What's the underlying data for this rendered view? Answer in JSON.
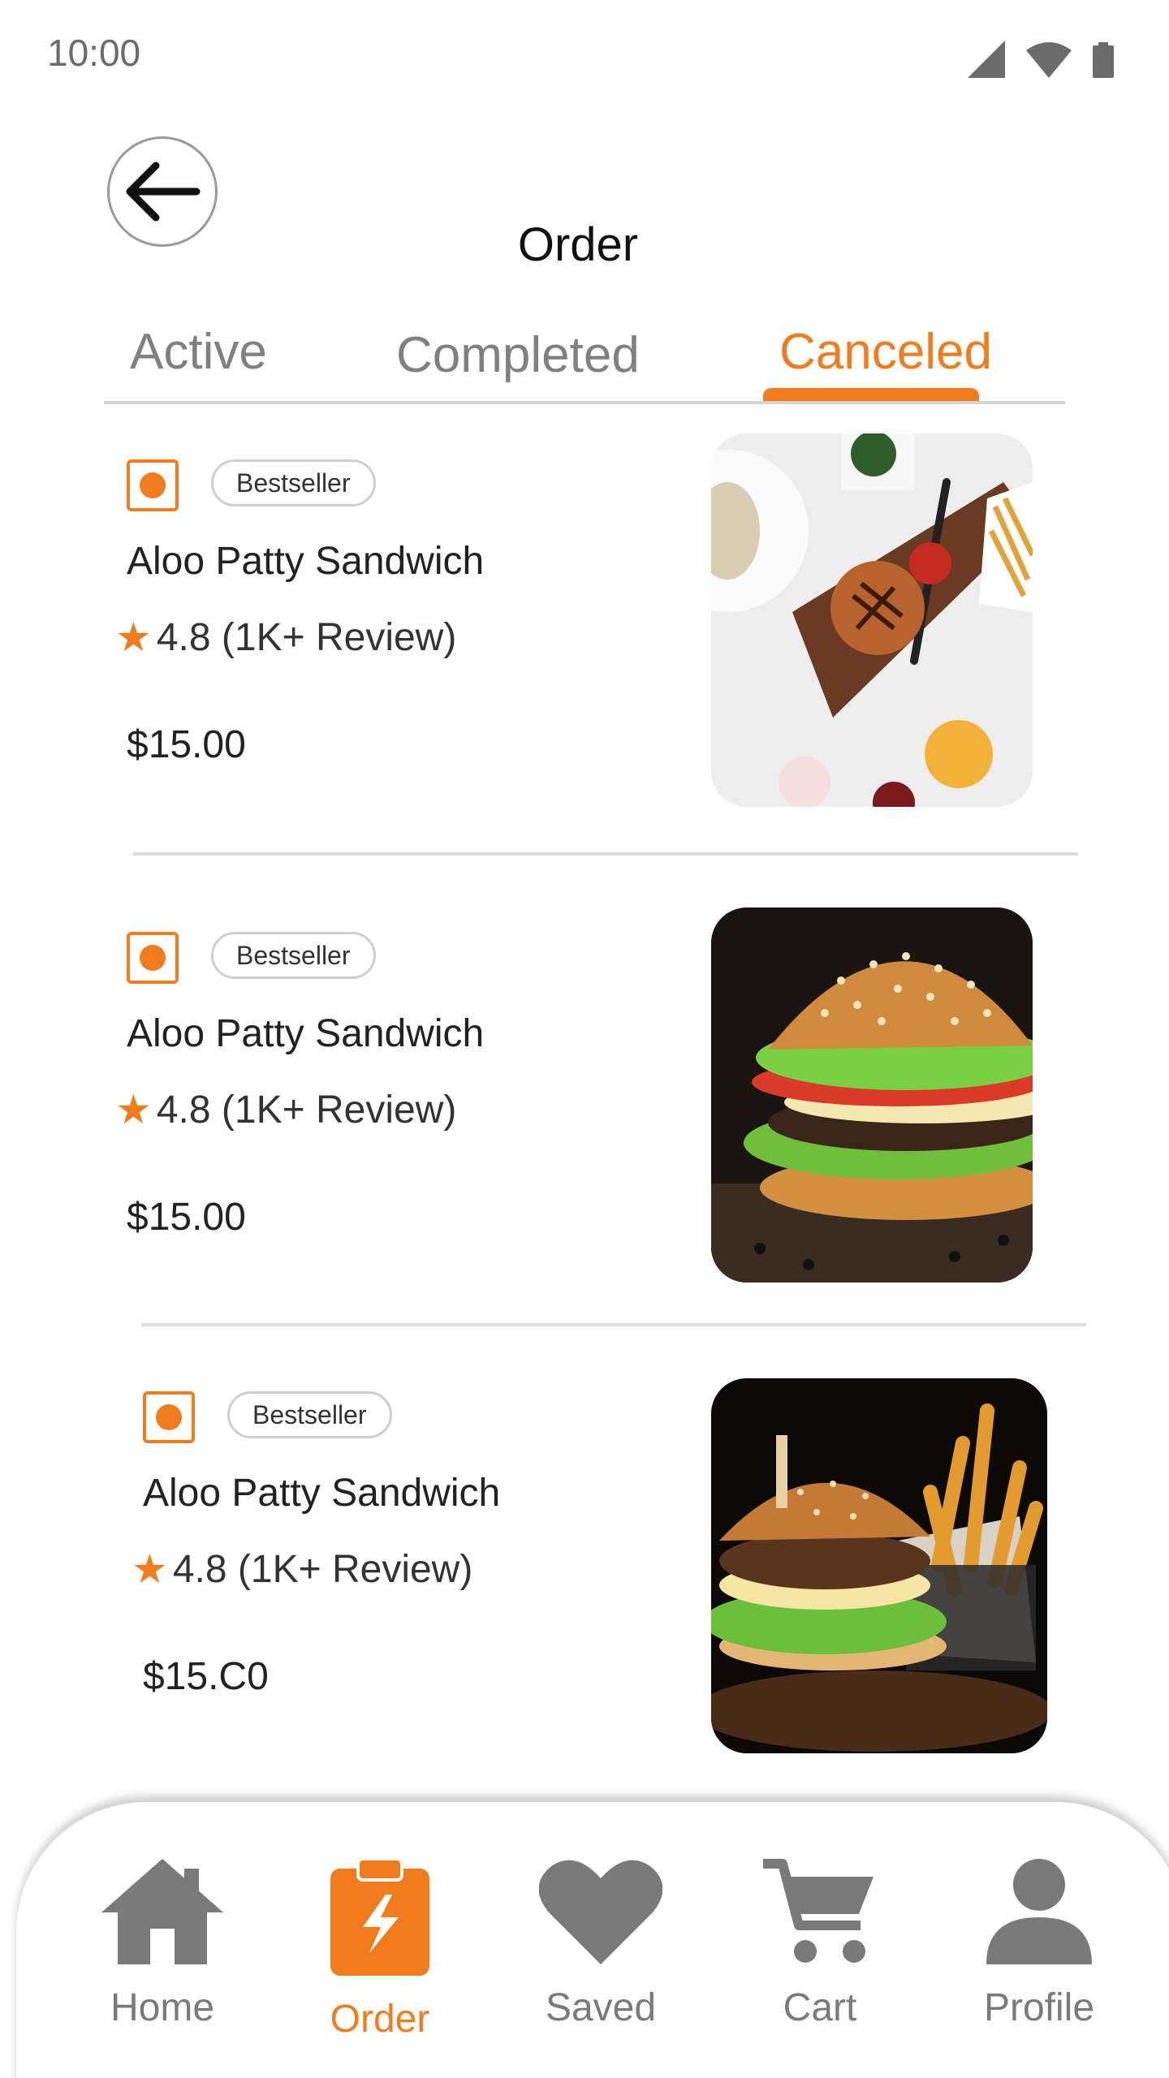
{
  "status_bar": {
    "time": "10:00"
  },
  "header": {
    "title": "Order"
  },
  "tabs": [
    {
      "label": "Active",
      "active": false
    },
    {
      "label": "Completed",
      "active": false
    },
    {
      "label": "Canceled",
      "active": true
    }
  ],
  "orders": [
    {
      "badge": "Bestseller",
      "name": "Aloo Patty Sandwich",
      "rating": "4.8 (1K+ Review)",
      "price": "$15.00",
      "image": "burger-on-board"
    },
    {
      "badge": "Bestseller",
      "name": "Aloo Patty Sandwich",
      "rating": "4.8 (1K+ Review)",
      "price": "$15.00",
      "image": "cheese-burger"
    },
    {
      "badge": "Bestseller",
      "name": "Aloo Patty Sandwich",
      "rating": "4.8 (1K+ Review)",
      "price": "$15.C0",
      "image": "burger-with-fries"
    }
  ],
  "bottom_nav": [
    {
      "label": "Home",
      "icon": "home-icon",
      "active": false
    },
    {
      "label": "Order",
      "icon": "order-clipboard-icon",
      "active": true
    },
    {
      "label": "Saved",
      "icon": "heart-icon",
      "active": false
    },
    {
      "label": "Cart",
      "icon": "cart-icon",
      "active": false
    },
    {
      "label": "Profile",
      "icon": "profile-icon",
      "active": false
    }
  ],
  "colors": {
    "accent": "#f07c1e",
    "icon_gray": "#7a7a7a",
    "text": "#222222"
  }
}
